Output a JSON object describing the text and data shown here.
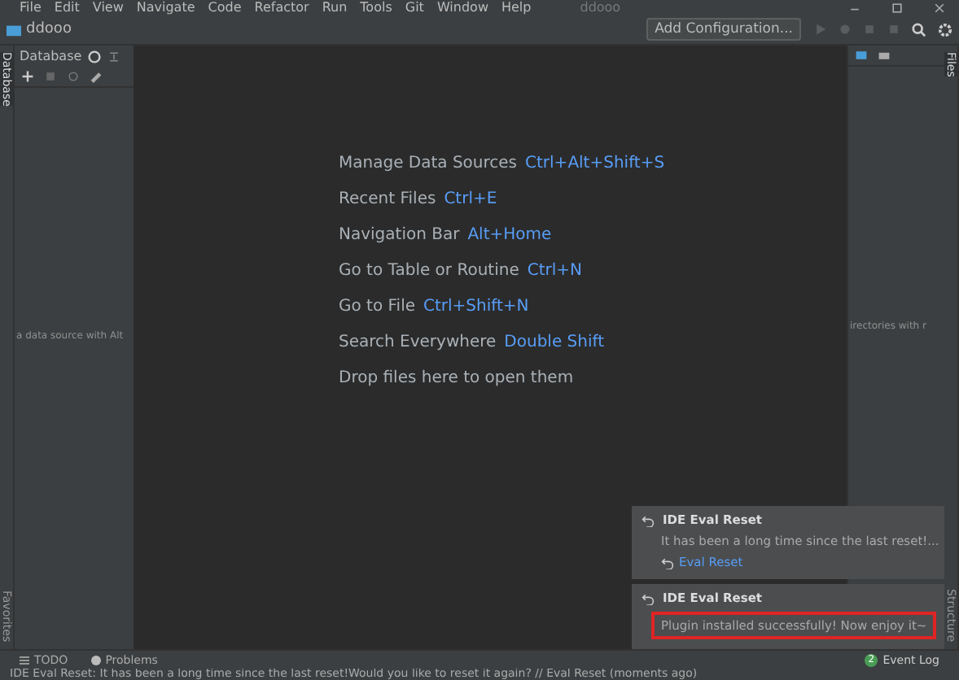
{
  "menu": [
    "File",
    "Edit",
    "View",
    "Navigate",
    "Code",
    "Refactor",
    "Run",
    "Tools",
    "Git",
    "Window",
    "Help"
  ],
  "window": {
    "title": "ddooo"
  },
  "navbar": {
    "project": "ddooo",
    "run_config": "Add Configuration..."
  },
  "left_stripe": {
    "top": "Database",
    "bottom": "Favorites"
  },
  "right_stripe": {
    "top": "Files",
    "bottom": "Structure"
  },
  "database_panel": {
    "title": "Database",
    "empty_text": "a data source with Alt"
  },
  "right_panel": {
    "empty_text": "irectories with r"
  },
  "welcome": [
    {
      "action": "Manage Data Sources",
      "shortcut": "Ctrl+Alt+Shift+S"
    },
    {
      "action": "Recent Files",
      "shortcut": "Ctrl+E"
    },
    {
      "action": "Navigation Bar",
      "shortcut": "Alt+Home"
    },
    {
      "action": "Go to Table or Routine",
      "shortcut": "Ctrl+N"
    },
    {
      "action": "Go to File",
      "shortcut": "Ctrl+Shift+N"
    },
    {
      "action": "Search Everywhere",
      "shortcut": "Double Shift"
    },
    {
      "action": "Drop files here to open them"
    }
  ],
  "notifications": [
    {
      "title": "IDE Eval Reset",
      "body": "It has been a long time since the last reset!...",
      "link": "Eval Reset",
      "highlighted": false
    },
    {
      "title": "IDE Eval Reset",
      "body": "Plugin installed successfully! Now enjoy it~",
      "highlighted": true
    }
  ],
  "tool_windows": [
    {
      "label": "TODO",
      "kind": "todo"
    },
    {
      "label": "Problems",
      "kind": "problems"
    }
  ],
  "event_log": {
    "label": "Event Log",
    "count": "2"
  },
  "status_bar": "IDE Eval Reset: It has been a long time since the last reset!Would you like to reset it again? // Eval Reset (moments ago)"
}
